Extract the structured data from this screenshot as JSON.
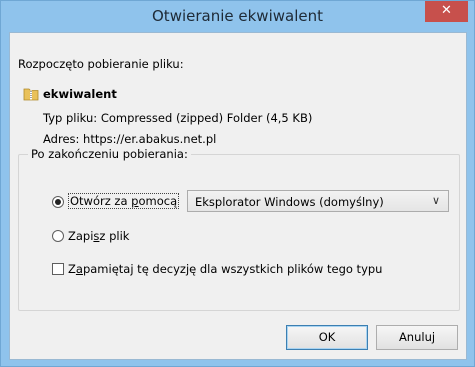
{
  "window": {
    "title": "Otwieranie ekwiwalent",
    "close_glyph": "✕"
  },
  "dialog": {
    "intro": "Rozpoczęto pobieranie pliku:",
    "file_icon": "zip-folder-icon",
    "file_name": "ekwiwalent",
    "file_type_label": "Typ pliku:",
    "file_type_value": "Compressed (zipped) Folder (4,5 KB)",
    "address_label": "Adres:",
    "address_value": "https://er.abakus.net.pl"
  },
  "after_download": {
    "legend": "Po zakończeniu pobierania:",
    "open_with": {
      "label_before": "Otwórz za ",
      "label_accel": "p",
      "label_after": "omocą",
      "selected": true
    },
    "open_with_app": "Eksplorator Windows (domyślny)",
    "save_file": {
      "label_before": "Zapi",
      "label_accel": "s",
      "label_after": "z plik",
      "selected": false
    },
    "remember": {
      "label_before": "Z",
      "label_accel": "a",
      "label_after": "pamiętaj tę decyzję dla wszystkich plików tego typu",
      "checked": false
    }
  },
  "buttons": {
    "ok": "OK",
    "cancel": "Anuluj"
  },
  "colors": {
    "titlebar": "#8fc3ec",
    "close": "#c7504c",
    "client": "#f0f0f0"
  }
}
